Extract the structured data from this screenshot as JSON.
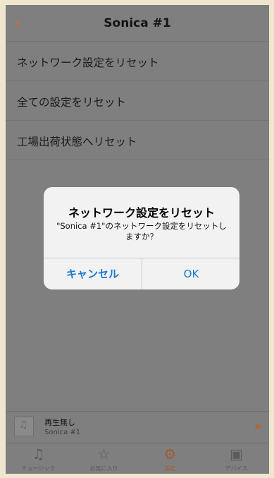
{
  "nav": {
    "back_icon": "chevron-left-icon",
    "title": "Sonica #1"
  },
  "menu": [
    {
      "label": "ネットワーク設定をリセット"
    },
    {
      "label": "全ての設定をリセット"
    },
    {
      "label": "工場出荷状態へリセット"
    }
  ],
  "dialog": {
    "title": "ネットワーク設定をリセット",
    "message": "\"Sonica #1\"のネットワーク設定をリセットしますか？",
    "cancel_label": "キャンセル",
    "ok_label": "OK"
  },
  "player": {
    "title": "再生無し",
    "subtitle": "Sonica #1"
  },
  "tabs": [
    {
      "label": "ミュージック",
      "icon": "music-note-icon"
    },
    {
      "label": "お気に入り",
      "icon": "star-icon"
    },
    {
      "label": "設定",
      "icon": "gear-icon",
      "active": true
    },
    {
      "label": "デバイス",
      "icon": "speaker-icon"
    }
  ],
  "colors": {
    "accent": "#c96e3d",
    "link": "#1a78d0",
    "dim_background": "#7f7f7f"
  }
}
